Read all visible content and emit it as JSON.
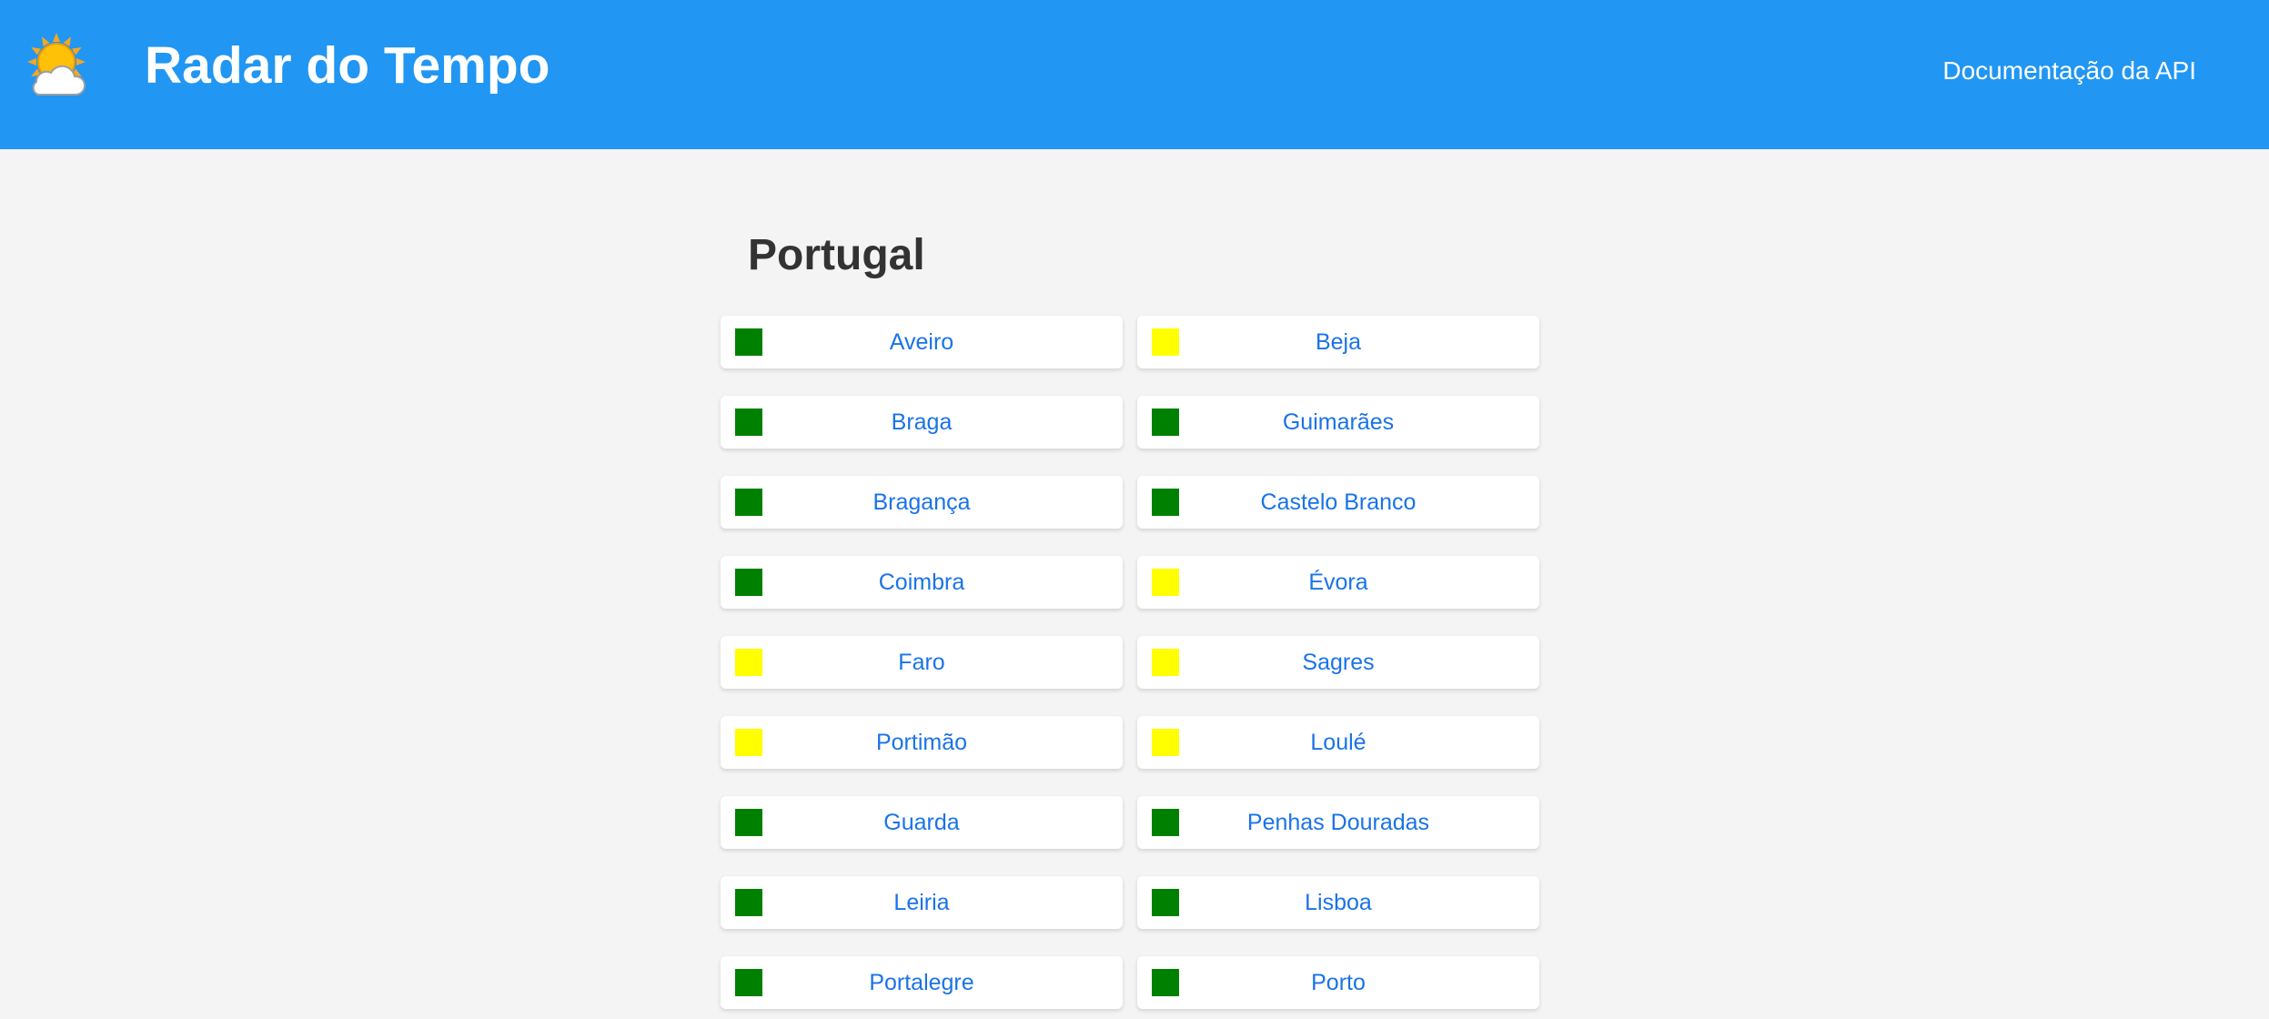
{
  "header": {
    "logo_icon": "sun-behind-cloud-icon",
    "title": "Radar do Tempo",
    "api_link": "Documentação da API"
  },
  "main": {
    "country": "Portugal",
    "status_colors": {
      "green": "#008000",
      "yellow": "#ffff00"
    },
    "cities": [
      {
        "name": "Aveiro",
        "status": "green"
      },
      {
        "name": "Beja",
        "status": "yellow"
      },
      {
        "name": "Braga",
        "status": "green"
      },
      {
        "name": "Guimarães",
        "status": "green"
      },
      {
        "name": "Bragança",
        "status": "green"
      },
      {
        "name": "Castelo Branco",
        "status": "green"
      },
      {
        "name": "Coimbra",
        "status": "green"
      },
      {
        "name": "Évora",
        "status": "yellow"
      },
      {
        "name": "Faro",
        "status": "yellow"
      },
      {
        "name": "Sagres",
        "status": "yellow"
      },
      {
        "name": "Portimão",
        "status": "yellow"
      },
      {
        "name": "Loulé",
        "status": "yellow"
      },
      {
        "name": "Guarda",
        "status": "green"
      },
      {
        "name": "Penhas Douradas",
        "status": "green"
      },
      {
        "name": "Leiria",
        "status": "green"
      },
      {
        "name": "Lisboa",
        "status": "green"
      },
      {
        "name": "Portalegre",
        "status": "green"
      },
      {
        "name": "Porto",
        "status": "green"
      }
    ]
  }
}
